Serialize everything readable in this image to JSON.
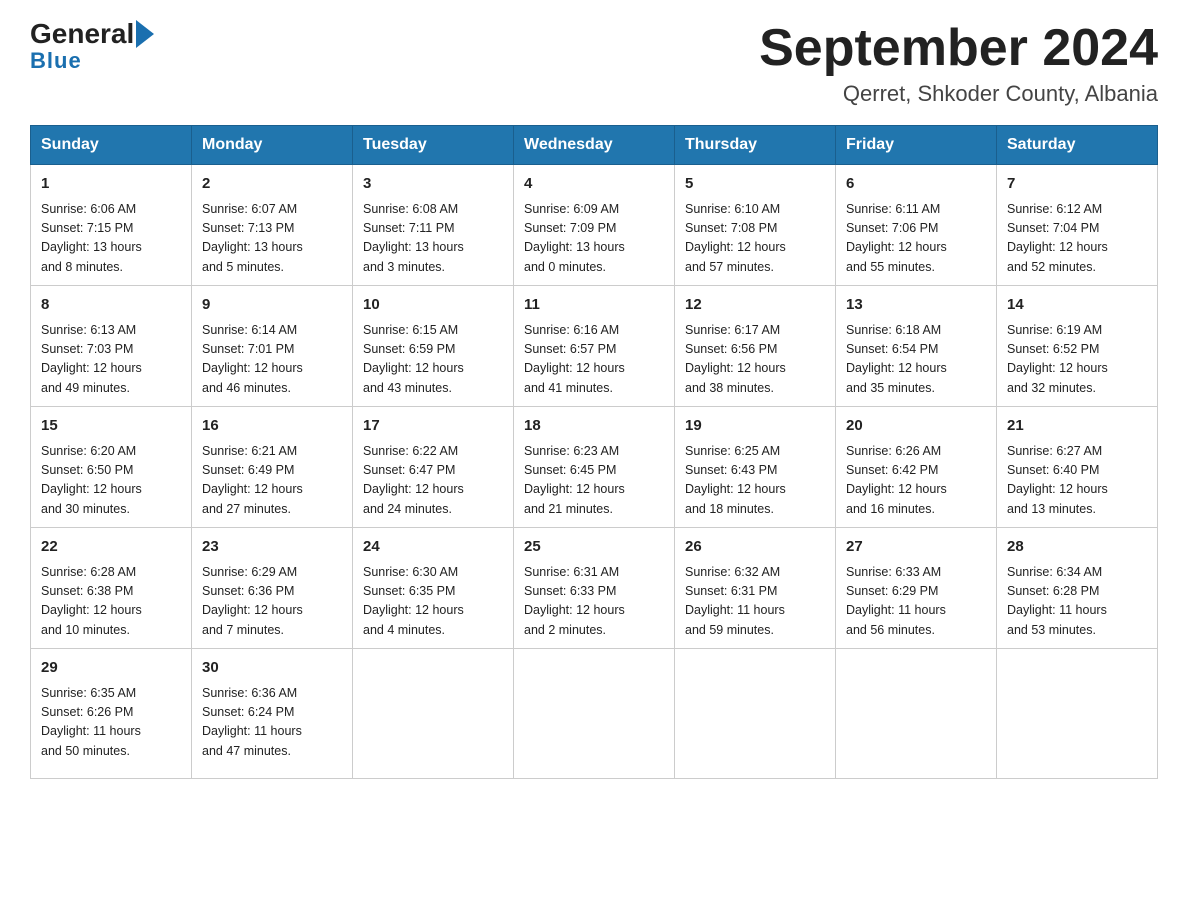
{
  "header": {
    "logo_general": "General",
    "logo_blue": "Blue",
    "title": "September 2024",
    "subtitle": "Qerret, Shkoder County, Albania"
  },
  "days_of_week": [
    "Sunday",
    "Monday",
    "Tuesday",
    "Wednesday",
    "Thursday",
    "Friday",
    "Saturday"
  ],
  "weeks": [
    [
      {
        "day": "1",
        "sunrise": "6:06 AM",
        "sunset": "7:15 PM",
        "daylight": "13 hours and 8 minutes."
      },
      {
        "day": "2",
        "sunrise": "6:07 AM",
        "sunset": "7:13 PM",
        "daylight": "13 hours and 5 minutes."
      },
      {
        "day": "3",
        "sunrise": "6:08 AM",
        "sunset": "7:11 PM",
        "daylight": "13 hours and 3 minutes."
      },
      {
        "day": "4",
        "sunrise": "6:09 AM",
        "sunset": "7:09 PM",
        "daylight": "13 hours and 0 minutes."
      },
      {
        "day": "5",
        "sunrise": "6:10 AM",
        "sunset": "7:08 PM",
        "daylight": "12 hours and 57 minutes."
      },
      {
        "day": "6",
        "sunrise": "6:11 AM",
        "sunset": "7:06 PM",
        "daylight": "12 hours and 55 minutes."
      },
      {
        "day": "7",
        "sunrise": "6:12 AM",
        "sunset": "7:04 PM",
        "daylight": "12 hours and 52 minutes."
      }
    ],
    [
      {
        "day": "8",
        "sunrise": "6:13 AM",
        "sunset": "7:03 PM",
        "daylight": "12 hours and 49 minutes."
      },
      {
        "day": "9",
        "sunrise": "6:14 AM",
        "sunset": "7:01 PM",
        "daylight": "12 hours and 46 minutes."
      },
      {
        "day": "10",
        "sunrise": "6:15 AM",
        "sunset": "6:59 PM",
        "daylight": "12 hours and 43 minutes."
      },
      {
        "day": "11",
        "sunrise": "6:16 AM",
        "sunset": "6:57 PM",
        "daylight": "12 hours and 41 minutes."
      },
      {
        "day": "12",
        "sunrise": "6:17 AM",
        "sunset": "6:56 PM",
        "daylight": "12 hours and 38 minutes."
      },
      {
        "day": "13",
        "sunrise": "6:18 AM",
        "sunset": "6:54 PM",
        "daylight": "12 hours and 35 minutes."
      },
      {
        "day": "14",
        "sunrise": "6:19 AM",
        "sunset": "6:52 PM",
        "daylight": "12 hours and 32 minutes."
      }
    ],
    [
      {
        "day": "15",
        "sunrise": "6:20 AM",
        "sunset": "6:50 PM",
        "daylight": "12 hours and 30 minutes."
      },
      {
        "day": "16",
        "sunrise": "6:21 AM",
        "sunset": "6:49 PM",
        "daylight": "12 hours and 27 minutes."
      },
      {
        "day": "17",
        "sunrise": "6:22 AM",
        "sunset": "6:47 PM",
        "daylight": "12 hours and 24 minutes."
      },
      {
        "day": "18",
        "sunrise": "6:23 AM",
        "sunset": "6:45 PM",
        "daylight": "12 hours and 21 minutes."
      },
      {
        "day": "19",
        "sunrise": "6:25 AM",
        "sunset": "6:43 PM",
        "daylight": "12 hours and 18 minutes."
      },
      {
        "day": "20",
        "sunrise": "6:26 AM",
        "sunset": "6:42 PM",
        "daylight": "12 hours and 16 minutes."
      },
      {
        "day": "21",
        "sunrise": "6:27 AM",
        "sunset": "6:40 PM",
        "daylight": "12 hours and 13 minutes."
      }
    ],
    [
      {
        "day": "22",
        "sunrise": "6:28 AM",
        "sunset": "6:38 PM",
        "daylight": "12 hours and 10 minutes."
      },
      {
        "day": "23",
        "sunrise": "6:29 AM",
        "sunset": "6:36 PM",
        "daylight": "12 hours and 7 minutes."
      },
      {
        "day": "24",
        "sunrise": "6:30 AM",
        "sunset": "6:35 PM",
        "daylight": "12 hours and 4 minutes."
      },
      {
        "day": "25",
        "sunrise": "6:31 AM",
        "sunset": "6:33 PM",
        "daylight": "12 hours and 2 minutes."
      },
      {
        "day": "26",
        "sunrise": "6:32 AM",
        "sunset": "6:31 PM",
        "daylight": "11 hours and 59 minutes."
      },
      {
        "day": "27",
        "sunrise": "6:33 AM",
        "sunset": "6:29 PM",
        "daylight": "11 hours and 56 minutes."
      },
      {
        "day": "28",
        "sunrise": "6:34 AM",
        "sunset": "6:28 PM",
        "daylight": "11 hours and 53 minutes."
      }
    ],
    [
      {
        "day": "29",
        "sunrise": "6:35 AM",
        "sunset": "6:26 PM",
        "daylight": "11 hours and 50 minutes."
      },
      {
        "day": "30",
        "sunrise": "6:36 AM",
        "sunset": "6:24 PM",
        "daylight": "11 hours and 47 minutes."
      },
      null,
      null,
      null,
      null,
      null
    ]
  ],
  "labels": {
    "sunrise": "Sunrise:",
    "sunset": "Sunset:",
    "daylight": "Daylight:"
  }
}
